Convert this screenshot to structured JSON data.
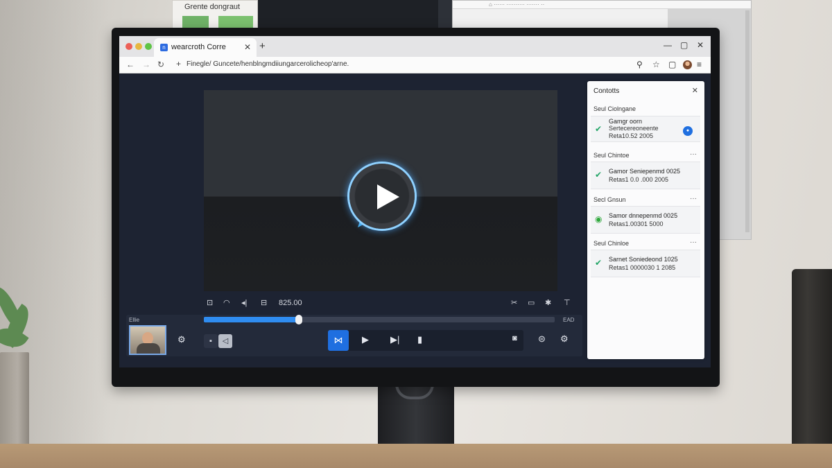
{
  "background": {
    "sheet_title": "Grente dongraut",
    "window_bar_text": "⌂ ······ ·········· ······· ··"
  },
  "browser": {
    "tab_title": "wearcroth Corre",
    "tab_favicon": "n",
    "url": "Finegle/ Guncete/henblngmdiiungarcerolicheop'arne.",
    "accent_color": "#2d6be0"
  },
  "player": {
    "time_display": "825.00",
    "label_left": "Ellie",
    "label_right": "EAD",
    "progress_percent": 27
  },
  "panel": {
    "title": "Contotts",
    "sections": [
      {
        "heading": "Seul Ciolngane",
        "more": "",
        "lines": [
          "Gamgr oorn",
          "Sertecereoneente",
          "Reta10.52 2005"
        ],
        "badge": true
      },
      {
        "heading": "Seul Chintoe",
        "more": "···",
        "lines": [
          "Gamor Seniepenmd 0025",
          "Retas1 0.0 .000 2005"
        ],
        "badge": false
      },
      {
        "heading": "Secl Gnsun",
        "more": "···",
        "lines": [
          "Samor dnnepenmd 0025",
          "Retas1.00301 5000"
        ],
        "badge": false
      },
      {
        "heading": "Seul Chinloe",
        "more": "···",
        "lines": [
          "Sarnet Soniedeond 1025",
          "Retas1 0000030 1 2085"
        ],
        "badge": false
      }
    ]
  }
}
